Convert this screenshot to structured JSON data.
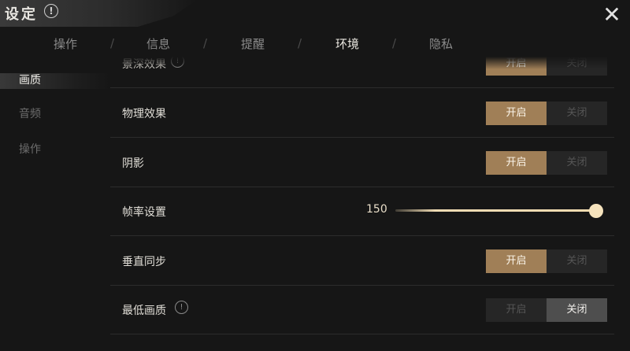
{
  "header": {
    "title": "设定",
    "info_glyph": "!",
    "close_glyph": "✕"
  },
  "tabs": [
    {
      "label": "操作",
      "active": false
    },
    {
      "label": "信息",
      "active": false
    },
    {
      "label": "提醒",
      "active": false
    },
    {
      "label": "环境",
      "active": true
    },
    {
      "label": "隐私",
      "active": false
    }
  ],
  "sidebar": {
    "items": [
      {
        "label": "画质",
        "active": true
      },
      {
        "label": "音频",
        "active": false
      },
      {
        "label": "操作",
        "active": false
      }
    ]
  },
  "settings": {
    "depth_of_field": {
      "label": "景深效果",
      "on_label": "开启",
      "off_label": "关闭",
      "value": "on",
      "info_glyph": "!"
    },
    "physics": {
      "label": "物理效果",
      "on_label": "开启",
      "off_label": "关闭",
      "value": "on"
    },
    "shadow": {
      "label": "阴影",
      "on_label": "开启",
      "off_label": "关闭",
      "value": "on"
    },
    "frame_rate": {
      "label": "帧率设置",
      "value": "150",
      "fraction": 1.0
    },
    "vsync": {
      "label": "垂直同步",
      "on_label": "开启",
      "off_label": "关闭",
      "value": "on"
    },
    "lowest_quality": {
      "label": "最低画质",
      "on_label": "开启",
      "off_label": "关闭",
      "value": "off",
      "info_glyph": "!"
    }
  },
  "colors": {
    "accent_on": "#a07f57",
    "selected_off": "#4e4e4e",
    "background": "#161616"
  }
}
